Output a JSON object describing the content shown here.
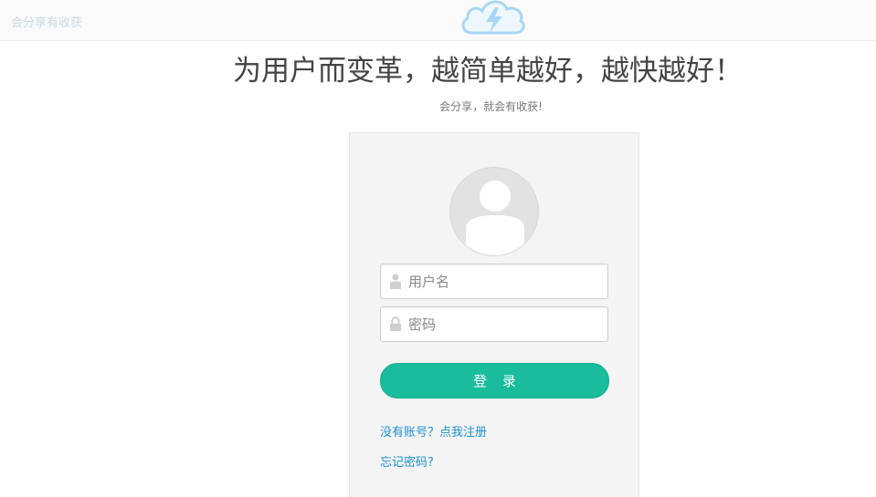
{
  "header": {
    "brand_text": "会分享有收获",
    "logo_icon": "cloud-lightning-icon",
    "accent_color": "#a9d6f5"
  },
  "hero": {
    "title": "为用户而变革，越简单越好，越快越好！",
    "subtitle": "会分享，就会有收获!"
  },
  "login": {
    "avatar_icon": "user-avatar-icon",
    "username_placeholder": "用户名",
    "username_icon": "user-icon",
    "password_placeholder": "密码",
    "password_icon": "lock-icon",
    "submit_label": "登 录",
    "submit_color": "#19bc9c",
    "register_link": "没有账号？点我注册",
    "forgot_link": "忘记密码?",
    "link_color": "#1e90d0"
  }
}
